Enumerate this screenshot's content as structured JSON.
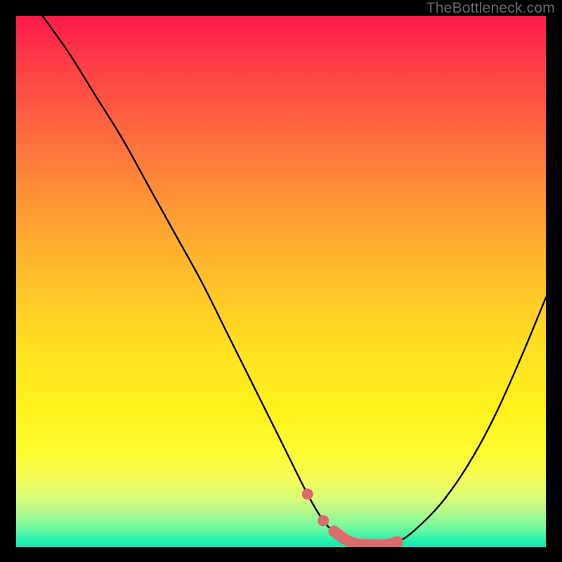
{
  "watermark": "TheBottleneck.com",
  "chart_data": {
    "type": "line",
    "title": "",
    "xlabel": "",
    "ylabel": "",
    "xlim": [
      0,
      100
    ],
    "ylim": [
      0,
      100
    ],
    "series": [
      {
        "name": "curve",
        "x": [
          5,
          10,
          15,
          20,
          25,
          30,
          35,
          40,
          45,
          50,
          55,
          58,
          60,
          63,
          66,
          70,
          72,
          75,
          80,
          85,
          90,
          95,
          100
        ],
        "y": [
          100,
          93,
          85,
          77,
          68,
          59,
          50,
          40,
          30,
          20,
          10,
          5,
          3,
          1,
          0.5,
          0.5,
          1,
          3,
          8,
          15,
          24,
          35,
          47
        ]
      }
    ],
    "highlight": {
      "name": "bottom-marker",
      "color": "#dd6b6b",
      "x": [
        55,
        58,
        60,
        63,
        66,
        70,
        72
      ],
      "y": [
        10,
        5,
        3,
        1,
        0.5,
        0.5,
        1
      ]
    }
  }
}
